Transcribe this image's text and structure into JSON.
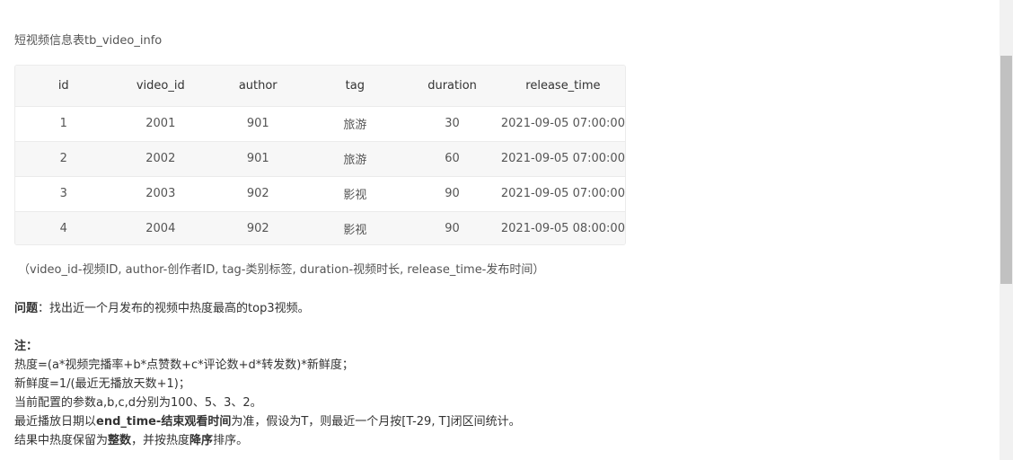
{
  "table_title": "短视频信息表tb_video_info",
  "table": {
    "headers": [
      "id",
      "video_id",
      "author",
      "tag",
      "duration",
      "release_time"
    ],
    "rows": [
      [
        "1",
        "2001",
        "901",
        "旅游",
        "30",
        "2021-09-05 07:00:00"
      ],
      [
        "2",
        "2002",
        "901",
        "旅游",
        "60",
        "2021-09-05 07:00:00"
      ],
      [
        "3",
        "2003",
        "902",
        "影视",
        "90",
        "2021-09-05 07:00:00"
      ],
      [
        "4",
        "2004",
        "902",
        "影视",
        "90",
        "2021-09-05 08:00:00"
      ]
    ]
  },
  "legend": "（video_id-视频ID, author-创作者ID, tag-类别标签, duration-视频时长, release_time-发布时间）",
  "question": {
    "label": "问题",
    "text": "：找出近一个月发布的视频中热度最高的top3视频。"
  },
  "note": {
    "label": "注",
    "colon": "：",
    "line1": "热度=(a*视频完播率+b*点赞数+c*评论数+d*转发数)*新鲜度；",
    "line2": "新鲜度=1/(最近无播放天数+1)；",
    "line3": "当前配置的参数a,b,c,d分别为100、5、3、2。",
    "line4_a": "最近播放日期以",
    "line4_b": "end_time-结束观看时间",
    "line4_c": "为准，假设为T，则最近一个月按[T-29, T]闭区间统计。",
    "line5_a": "结果中热度保留为",
    "line5_b": "整数",
    "line5_c": "，并按热度",
    "line5_d": "降序",
    "line5_e": "排序。"
  }
}
